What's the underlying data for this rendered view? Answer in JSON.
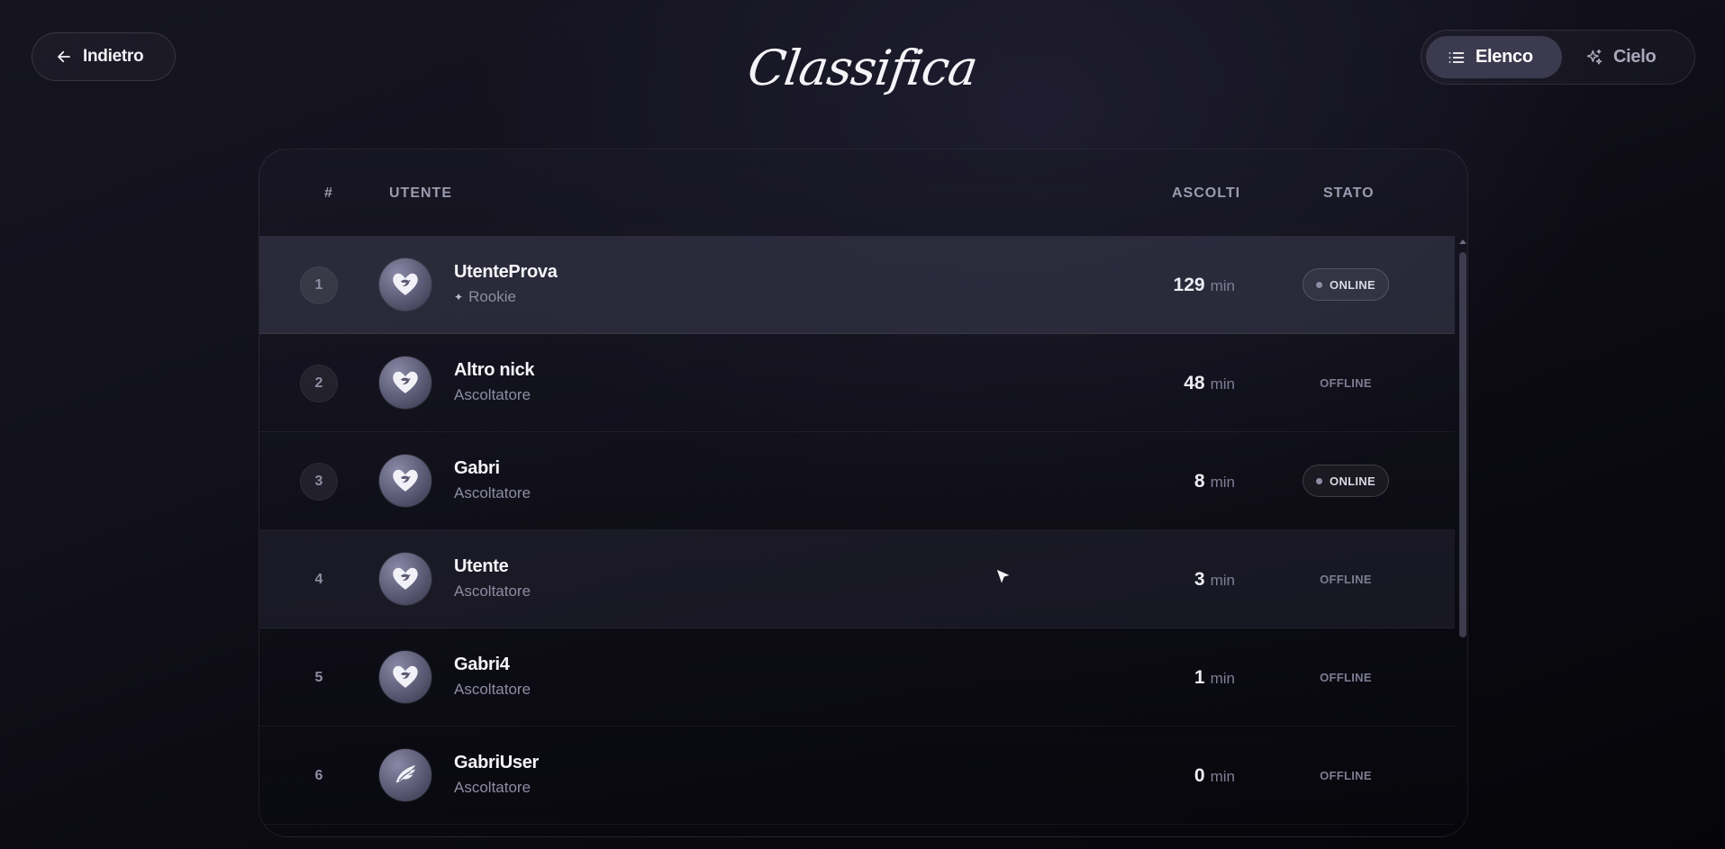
{
  "header": {
    "back_label": "Indietro",
    "title": "Classifica",
    "view_toggle": {
      "options": [
        {
          "label": "Elenco",
          "icon": "list-icon",
          "active": true
        },
        {
          "label": "Cielo",
          "icon": "sparkles-icon",
          "active": false
        }
      ]
    }
  },
  "table": {
    "columns": {
      "rank": "#",
      "user": "UTENTE",
      "listens": "ASCOLTI",
      "status": "STATO"
    },
    "unit": "min",
    "rows": [
      {
        "rank": "1",
        "name": "UtenteProva",
        "role": "Rookie",
        "minutes": "129",
        "status": "ONLINE",
        "avatar": "heart-bird-icon"
      },
      {
        "rank": "2",
        "name": "Altro nick",
        "role": "Ascoltatore",
        "minutes": "48",
        "status": "OFFLINE",
        "avatar": "heart-bird-icon"
      },
      {
        "rank": "3",
        "name": "Gabri",
        "role": "Ascoltatore",
        "minutes": "8",
        "status": "ONLINE",
        "avatar": "heart-bird-icon"
      },
      {
        "rank": "4",
        "name": "Utente",
        "role": "Ascoltatore",
        "minutes": "3",
        "status": "OFFLINE",
        "avatar": "heart-bird-icon"
      },
      {
        "rank": "5",
        "name": "Gabri4",
        "role": "Ascoltatore",
        "minutes": "1",
        "status": "OFFLINE",
        "avatar": "heart-bird-icon"
      },
      {
        "rank": "6",
        "name": "GabriUser",
        "role": "Ascoltatore",
        "minutes": "0",
        "status": "OFFLINE",
        "avatar": "wing-icon"
      }
    ]
  },
  "colors": {
    "background": "#12111c",
    "accent": "#3b3a4f",
    "text_primary": "#f4f4f9",
    "text_muted": "#8d8ca3"
  }
}
